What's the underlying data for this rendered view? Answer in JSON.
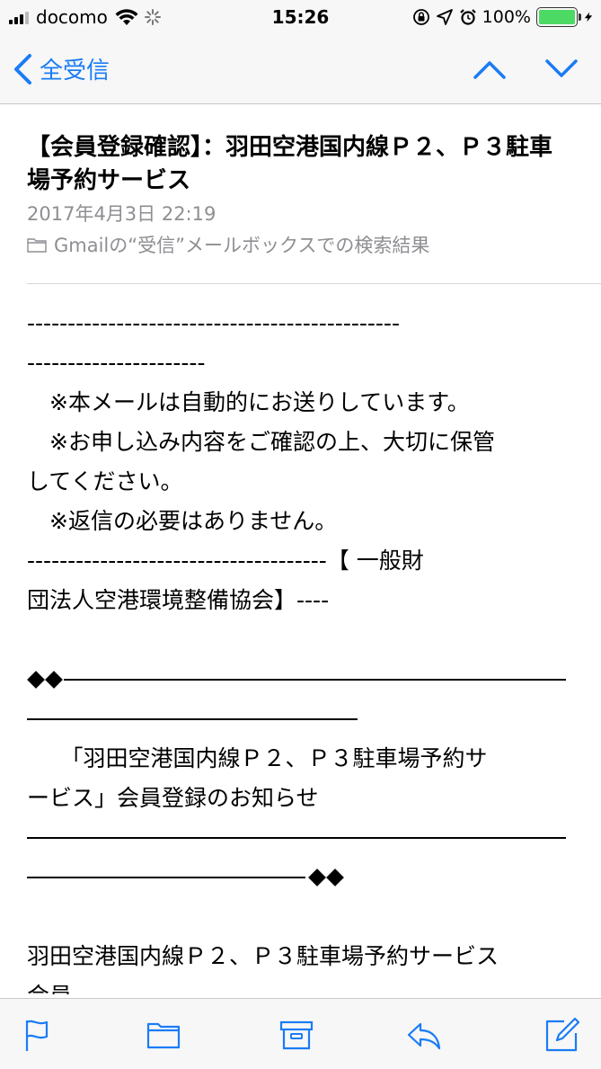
{
  "status_bar": {
    "carrier": "docomo",
    "time": "15:26",
    "battery": "100%"
  },
  "nav": {
    "back_label": "全受信",
    "icons": [
      "chevron-left-icon",
      "arrow-up-icon",
      "arrow-down-icon"
    ]
  },
  "header": {
    "subject": "【会員登録確認】：羽田空港国内線Ｐ２、Ｐ３駐車場予約サービス",
    "date": "2017年4月3日 22:19",
    "mailbox": "Gmailの“受信”メールボックスでの検索結果"
  },
  "body": {
    "dash_line_1": "----------------------------------------------",
    "dash_line_2": "----------------------",
    "notice_1": "　※本メールは自動的にお送りしています。",
    "notice_2": "　※お申し込み内容をご確認の上、大切に保管",
    "notice_3": "してください。",
    "notice_4": "　※返信の必要はありません。",
    "org_line_1": "-------------------------------------【 一般財",
    "org_line_2": "団法人空港環境整備協会】----",
    "title_line_1": "　　「羽田空港国内線Ｐ２、Ｐ３駐車場予約サ",
    "title_line_2": "ービス」会員登録のお知らせ",
    "member_line_1": "羽田空港国内線Ｐ２、Ｐ３駐車場予約サービス",
    "member_line_2": "会員"
  },
  "toolbar": {
    "icons": [
      "flag-icon",
      "folder-icon",
      "archive-icon",
      "reply-icon",
      "compose-icon"
    ]
  },
  "colors": {
    "accent": "#1a7cf5",
    "secondary_text": "#8e8e93",
    "battery": "#4cd964",
    "bar_background": "#f7f7f7"
  }
}
